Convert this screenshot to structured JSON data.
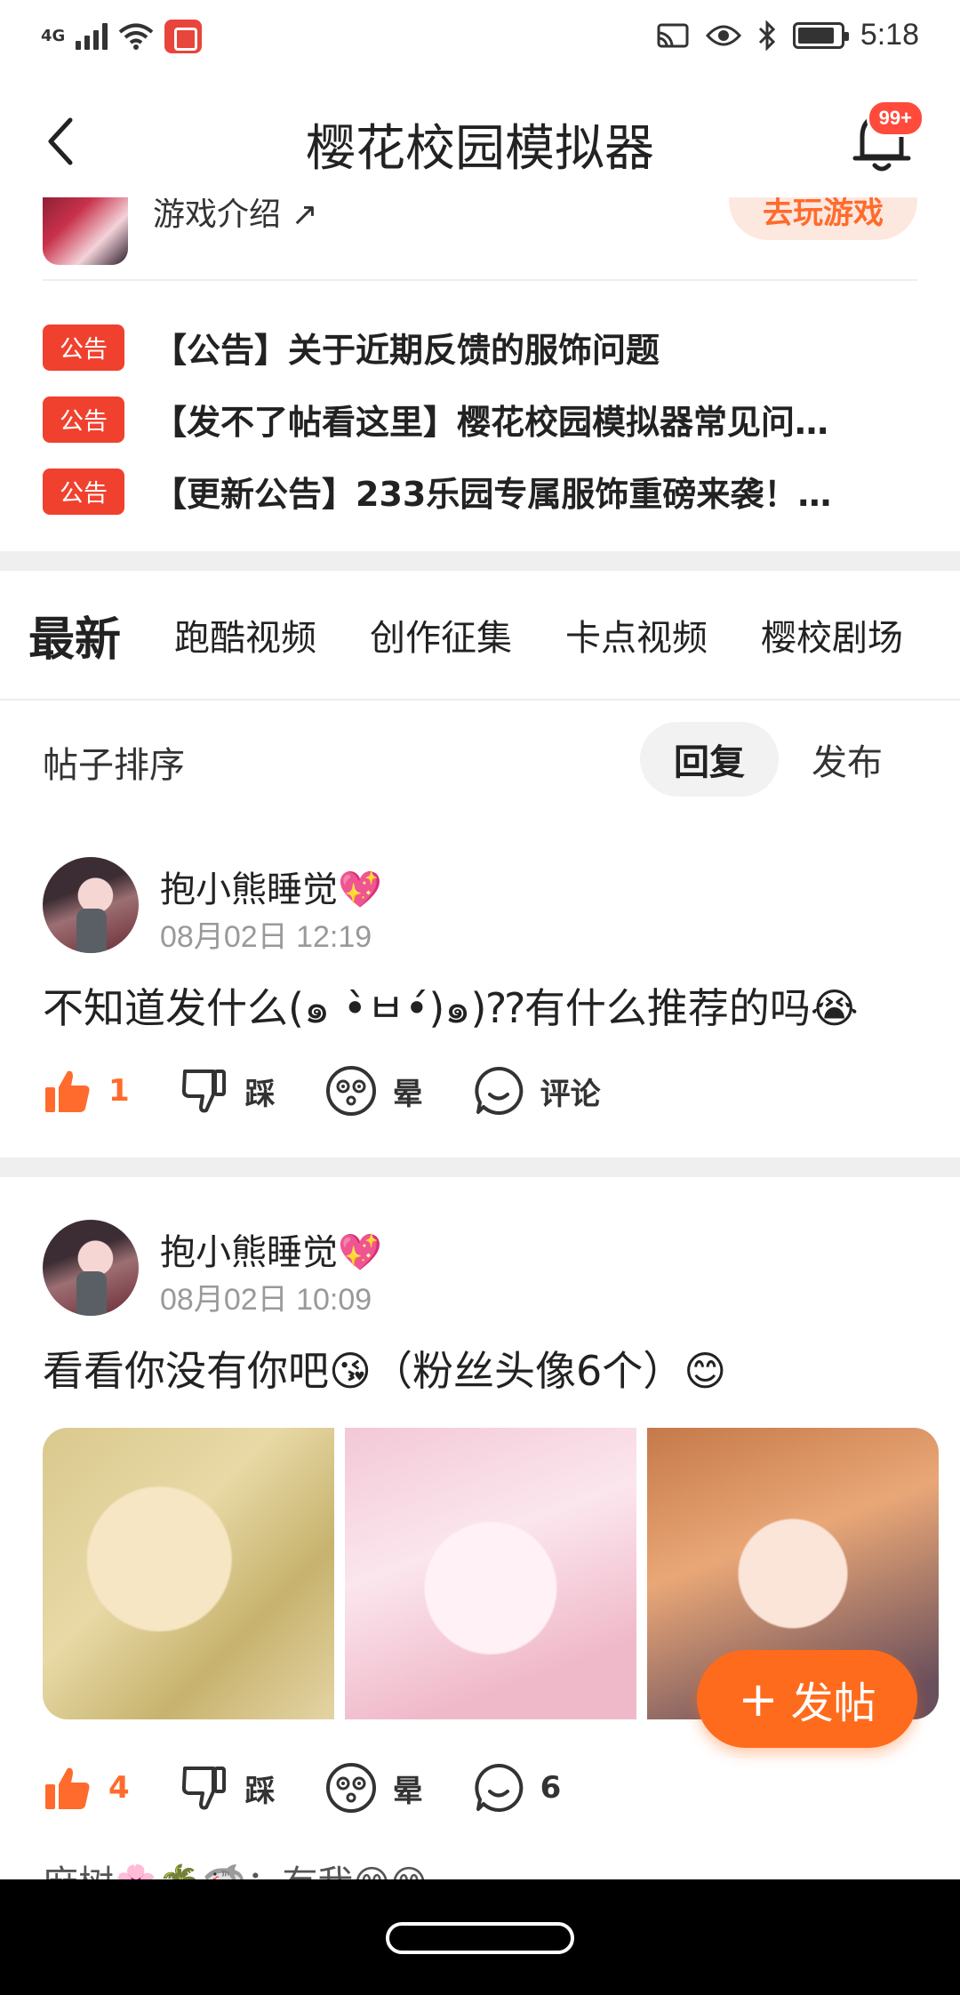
{
  "status_bar": {
    "network": "4G",
    "time": "5:18"
  },
  "header": {
    "title": "樱花校园模拟器",
    "badge": "99+"
  },
  "game": {
    "intro_label": "游戏介绍 ↗",
    "play_label": "去玩游戏"
  },
  "notices": [
    {
      "tag": "公告",
      "text": "【公告】关于近期反馈的服饰问题"
    },
    {
      "tag": "公告",
      "text": "【发不了帖看这里】樱花校园模拟器常见问…"
    },
    {
      "tag": "公告",
      "text": "【更新公告】233乐园专属服饰重磅来袭！…"
    }
  ],
  "tabs": [
    "最新",
    "跑酷视频",
    "创作征集",
    "卡点视频",
    "樱校剧场"
  ],
  "sort": {
    "label": "帖子排序",
    "options": [
      "回复",
      "发布"
    ],
    "selected": "回复"
  },
  "posts": [
    {
      "author": "抱小熊睡觉💖",
      "time": "08月02日 12:19",
      "text": "不知道发什么(๑ •̀ㅂ•́)๑)⁇有什么推荐的吗😭",
      "actions": {
        "like": "1",
        "dislike": "踩",
        "dizzy": "晕",
        "comment": "评论"
      }
    },
    {
      "author": "抱小熊睡觉💖",
      "time": "08月02日 10:09",
      "text": "看看你没有你吧😘（粉丝头像6个）😊",
      "actions": {
        "like": "4",
        "dislike": "踩",
        "dizzy": "晕",
        "comment": "6"
      }
    }
  ],
  "fab": {
    "label": "发帖"
  },
  "comment_preview": "麻树🌸🌴🦈：有我😁😁",
  "colors": {
    "accent": "#ff6b2c",
    "notice_tag": "#f0412f"
  }
}
